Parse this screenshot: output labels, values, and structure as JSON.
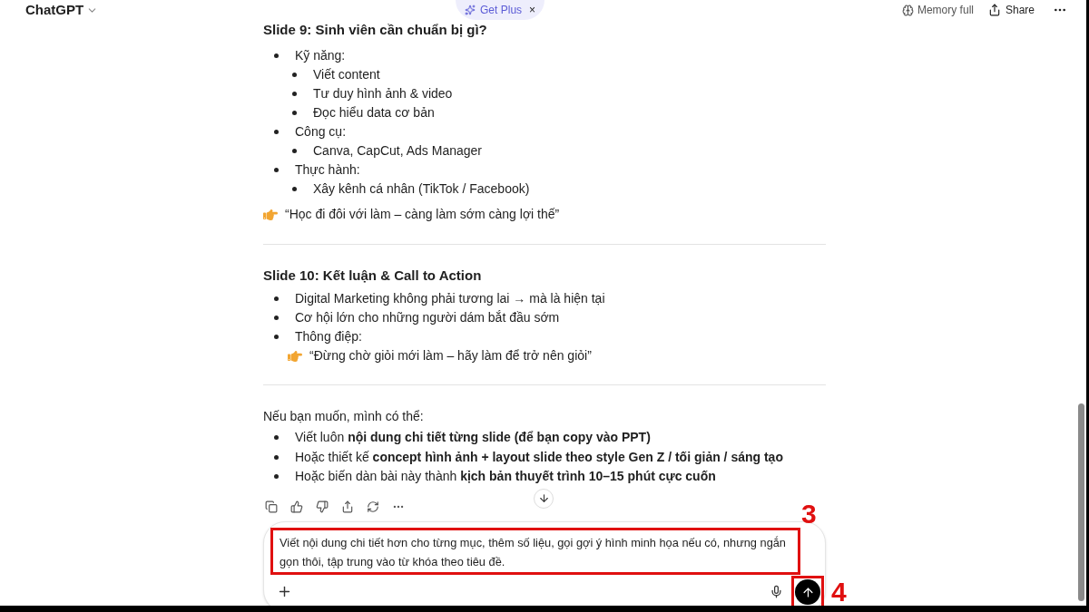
{
  "header": {
    "title": "ChatGPT",
    "get_plus": {
      "label": "Get Plus",
      "close": "×"
    },
    "memory": "Memory full",
    "share": "Share"
  },
  "slide9": {
    "heading": "Slide 9: Sinh viên cần chuẩn bị gì?",
    "items": [
      {
        "text": "Kỹ năng:",
        "children": [
          {
            "text": "Viết content"
          },
          {
            "text": "Tư duy hình ảnh & video"
          },
          {
            "text": "Đọc hiểu data cơ bản"
          }
        ]
      },
      {
        "text": "Công cụ:",
        "children": [
          {
            "text": "Canva, CapCut, Ads Manager"
          }
        ]
      },
      {
        "text": "Thực hành:",
        "children": [
          {
            "text": "Xây kênh cá nhân (TikTok / Facebook)"
          }
        ]
      }
    ],
    "quote": "“Học đi đôi với làm – càng làm sớm càng lợi thế”"
  },
  "slide10": {
    "heading": "Slide 10: Kết luận & Call to Action",
    "items": [
      {
        "text": "Digital Marketing không phải tương lai → mà là hiện tại"
      },
      {
        "text": "Cơ hội lớn cho những người dám bắt đầu sớm"
      },
      {
        "text": "Thông điệp:",
        "quote": "“Đừng chờ giỏi mới làm – hãy làm để trở nên giỏi”"
      }
    ]
  },
  "outro": {
    "intro": "Nếu bạn muốn, mình có thể:",
    "items": [
      "Viết luôn **nội dung chi tiết từng slide (để bạn copy vào PPT)**",
      "Hoặc thiết kế **concept hình ảnh + layout slide theo style Gen Z / tối giản / sáng tạo**",
      "Hoặc biến dàn bài này thành **kịch bản thuyết trình 10–15 phút cực cuốn**"
    ]
  },
  "composer": {
    "value": "Viết nội dung chi tiết hơn cho từng mục, thêm số liệu, gọi gợi ý hình minh họa nếu có, nhưng ngắn gọn thôi, tập trung vào từ khóa theo tiêu đề."
  },
  "annotations": [
    {
      "label": "3"
    },
    {
      "label": "4"
    }
  ]
}
